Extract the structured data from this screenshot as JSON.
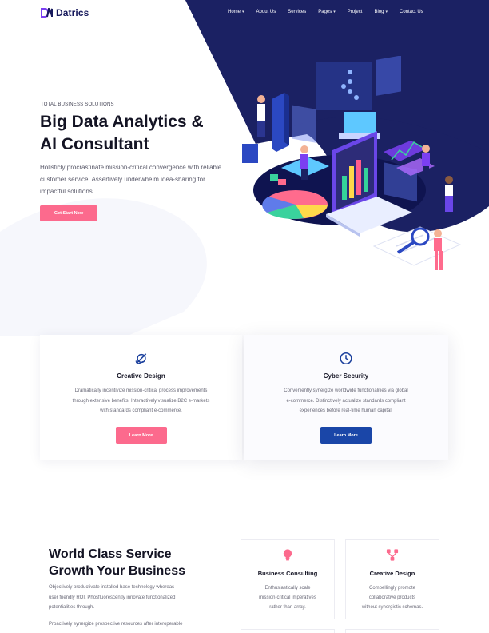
{
  "brand": {
    "name": "Datrics",
    "logo_color": "#7b3ff2",
    "primary_color": "#17195c"
  },
  "nav": {
    "items": [
      {
        "label": "Home",
        "has_dropdown": true
      },
      {
        "label": "About Us",
        "has_dropdown": false
      },
      {
        "label": "Services",
        "has_dropdown": false
      },
      {
        "label": "Pages",
        "has_dropdown": true
      },
      {
        "label": "Project",
        "has_dropdown": false
      },
      {
        "label": "Blog",
        "has_dropdown": true
      },
      {
        "label": "Contact Us",
        "has_dropdown": false
      }
    ],
    "dropdown_icon": "chevron-down-icon"
  },
  "hero": {
    "eyebrow": "TOTAL BUSINESS SOLUTIONS",
    "title_line1": "Big Data Analytics &",
    "title_line2": "AI Consultant",
    "description": "Holisticly procrastinate mission-critical convergence with reliable customer service. Assertively underwhelm idea-sharing for impactful solutions.",
    "cta_label": "Get Start Now",
    "cta_color": "#fc6a8d",
    "illustration": "isometric-data-analytics-illustration",
    "shape_color": "#1b2163"
  },
  "features": [
    {
      "icon": "orbit-icon",
      "title": "Creative Design",
      "lines": [
        "Dramatically incentivize mission-critical process improvements",
        "through extensive benefits. Interactively visualize B2C e-markets",
        "with standards compliant e-commerce."
      ],
      "button": "Learn More",
      "button_color": "#fc6a8d"
    },
    {
      "icon": "clock-icon",
      "title": "Cyber Security",
      "lines": [
        "Conveniently synergize worldwide functionalities via global",
        "e-commerce. Distinctively actualize standards compliant",
        "experiences before real-time human capital."
      ],
      "button": "Learn More",
      "button_color": "#1a46a8"
    }
  ],
  "services": {
    "title_line1": "World Class Service",
    "title_line2": "Growth Your Business",
    "para1_lines": [
      "Objectively productivate installed base technology whereas",
      "user friendly ROI. Phosfluorescently innovate functionalized",
      "potentialities through."
    ],
    "para2_lines": [
      "Proactively synergize prospective resources after interoperable"
    ],
    "cards": [
      {
        "icon": "lightbulb-icon",
        "title": "Business Consulting",
        "lines": [
          "Enthusiastically scale",
          "mission-critical imperatives",
          "rather than array."
        ]
      },
      {
        "icon": "network-icon",
        "title": "Creative Design",
        "lines": [
          "Compellingly promote",
          "collaborative products",
          "without synergistic schemas."
        ]
      }
    ],
    "icon_color": "#fc6a8d"
  }
}
